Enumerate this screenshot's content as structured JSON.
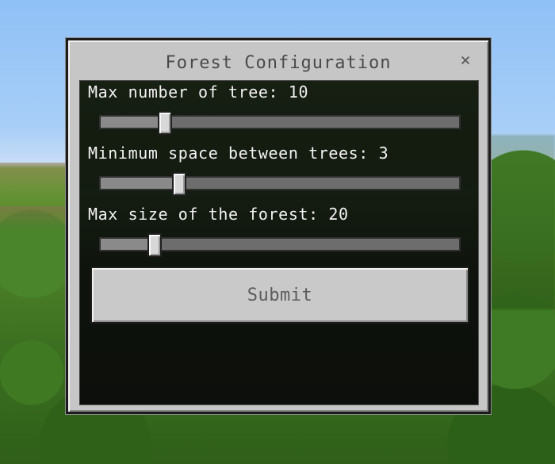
{
  "dialog": {
    "title": "Forest Configuration",
    "close_label": "×"
  },
  "settings": [
    {
      "label": "Max number of tree: 10",
      "value": 10,
      "level_percent": 18
    },
    {
      "label": "Minimum space between trees: 3",
      "value": 3,
      "level_percent": 22
    },
    {
      "label": "Max size of the forest: 20",
      "value": 20,
      "level_percent": 15
    }
  ],
  "submit_label": "Submit",
  "colors": {
    "panel": "#c6c6c6",
    "text": "#f2f2f2",
    "title": "#4a4a4a",
    "button": "#c9c9c9"
  }
}
